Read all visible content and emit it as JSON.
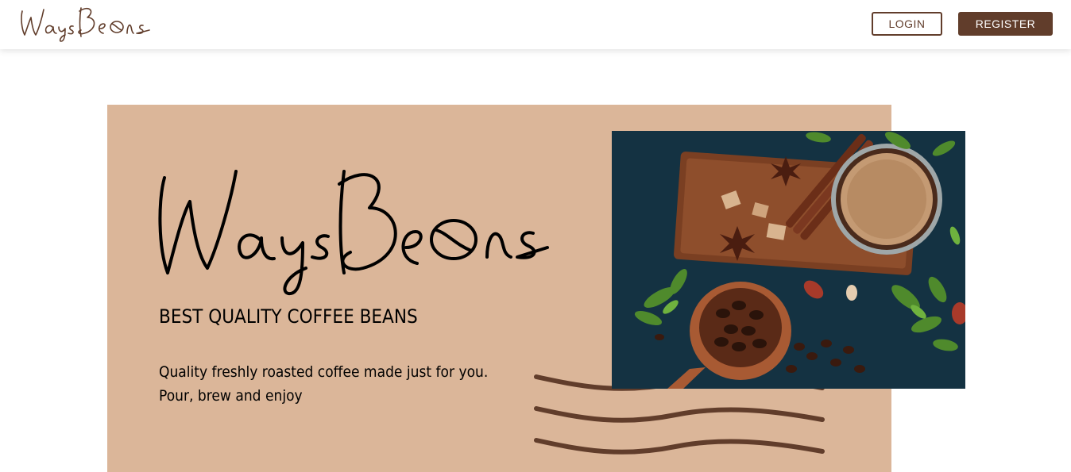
{
  "navbar": {
    "brand": "WaysBeans",
    "login_label": "LOGIN",
    "register_label": "REGISTER"
  },
  "hero": {
    "brand": "WaysBeans",
    "tagline": "BEST QUALITY COFFEE BEANS",
    "description_line1": "Quality freshly roasted coffee made just for you.",
    "description_line2": "Pour, brew and enjoy",
    "image": "coffee-cup-and-beans-photo"
  },
  "colors": {
    "brand_brown": "#613d2b",
    "hero_background": "#dbb699",
    "page_background": "#ffffff"
  }
}
